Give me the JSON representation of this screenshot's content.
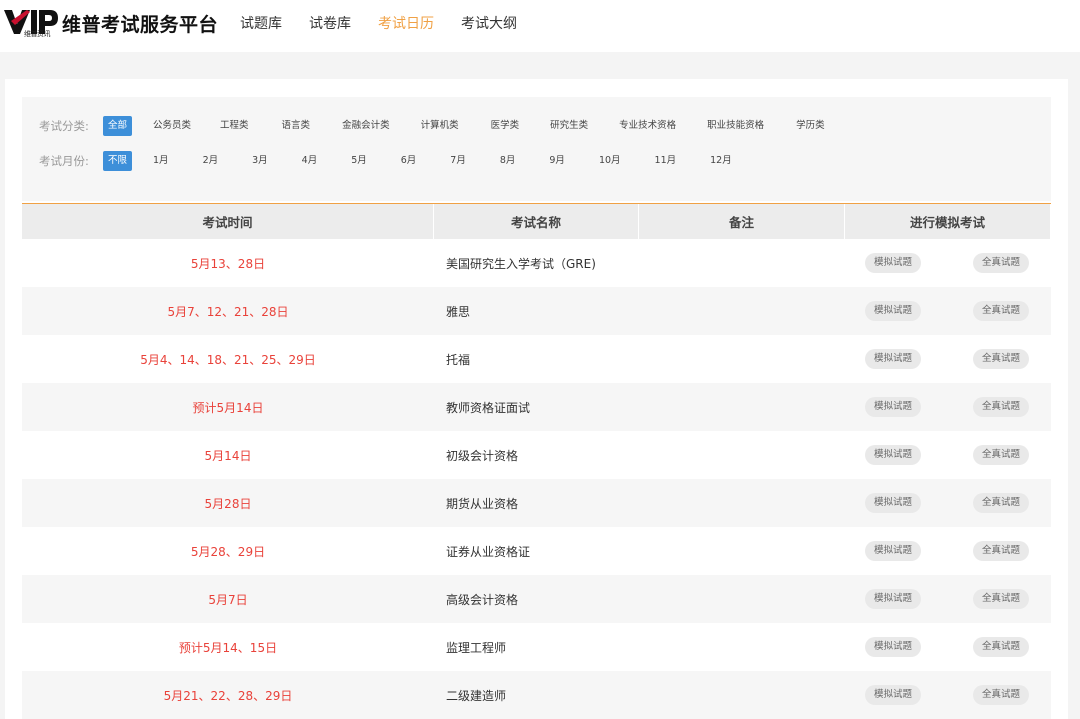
{
  "header": {
    "logo_text": "VIP",
    "logo_sub": "维普资讯",
    "brand": "维普考试服务平台",
    "nav": [
      {
        "label": "试题库",
        "active": false
      },
      {
        "label": "试卷库",
        "active": false
      },
      {
        "label": "考试日历",
        "active": true
      },
      {
        "label": "考试大纲",
        "active": false
      }
    ],
    "accent_color": "#f0a145",
    "logo_color": "#c8102e"
  },
  "filters": {
    "category_label": "考试分类:",
    "categories": [
      "全部",
      "公务员类",
      "工程类",
      "语言类",
      "金融会计类",
      "计算机类",
      "医学类",
      "研究生类",
      "专业技术资格",
      "职业技能资格",
      "学历类"
    ],
    "category_selected": "全部",
    "month_label": "考试月份:",
    "months": [
      "不限",
      "1月",
      "2月",
      "3月",
      "4月",
      "5月",
      "6月",
      "7月",
      "8月",
      "9月",
      "10月",
      "11月",
      "12月"
    ],
    "month_selected": "不限",
    "selected_color": "#3d8fd9"
  },
  "table": {
    "headers": [
      "考试时间",
      "考试名称",
      "备注",
      "进行模拟考试"
    ],
    "button_mock": "模拟试题",
    "button_real": "全真试题",
    "time_color": "#e9423a",
    "rows": [
      {
        "time": "5月13、28日",
        "name": "美国研究生入学考试（GRE)",
        "note": ""
      },
      {
        "time": "5月7、12、21、28日",
        "name": "雅思",
        "note": ""
      },
      {
        "time": "5月4、14、18、21、25、29日",
        "name": "托福",
        "note": ""
      },
      {
        "time": "预计5月14日",
        "name": "教师资格证面试",
        "note": ""
      },
      {
        "time": "5月14日",
        "name": "初级会计资格",
        "note": ""
      },
      {
        "time": "5月28日",
        "name": "期货从业资格",
        "note": ""
      },
      {
        "time": "5月28、29日",
        "name": "证券从业资格证",
        "note": ""
      },
      {
        "time": "5月7日",
        "name": "高级会计资格",
        "note": ""
      },
      {
        "time": "预计5月14、15日",
        "name": "监理工程师",
        "note": ""
      },
      {
        "time": "5月21、22、28、29日",
        "name": "二级建造师",
        "note": ""
      }
    ]
  }
}
